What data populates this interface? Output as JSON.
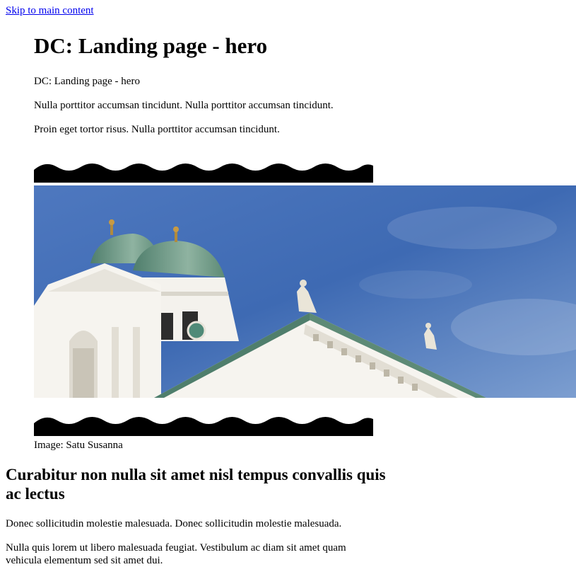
{
  "skip_link": "Skip to main content",
  "hero": {
    "title": "DC: Landing page - hero",
    "subtitle": "DC: Landing page - hero",
    "paragraphs": [
      "Nulla porttitor accumsan tincidunt. Nulla porttitor accumsan tincidunt.",
      "Proin eget tortor risus. Nulla porttitor accumsan tincidunt."
    ],
    "caption": "Image: Satu Susanna"
  },
  "section": {
    "heading": "Curabitur non nulla sit amet nisl tempus convallis quis ac lectus",
    "paragraphs": [
      "Donec sollicitudin molestie malesuada. Donec sollicitudin molestie malesuada.",
      "Nulla quis lorem ut libero malesuada feugiat. Vestibulum ac diam sit amet quam vehicula elementum sed sit amet dui."
    ]
  },
  "colors": {
    "link": "#0000ee",
    "sky": "#3f6ab3",
    "dome": "#6e9a85",
    "building": "#f3f1ec"
  }
}
